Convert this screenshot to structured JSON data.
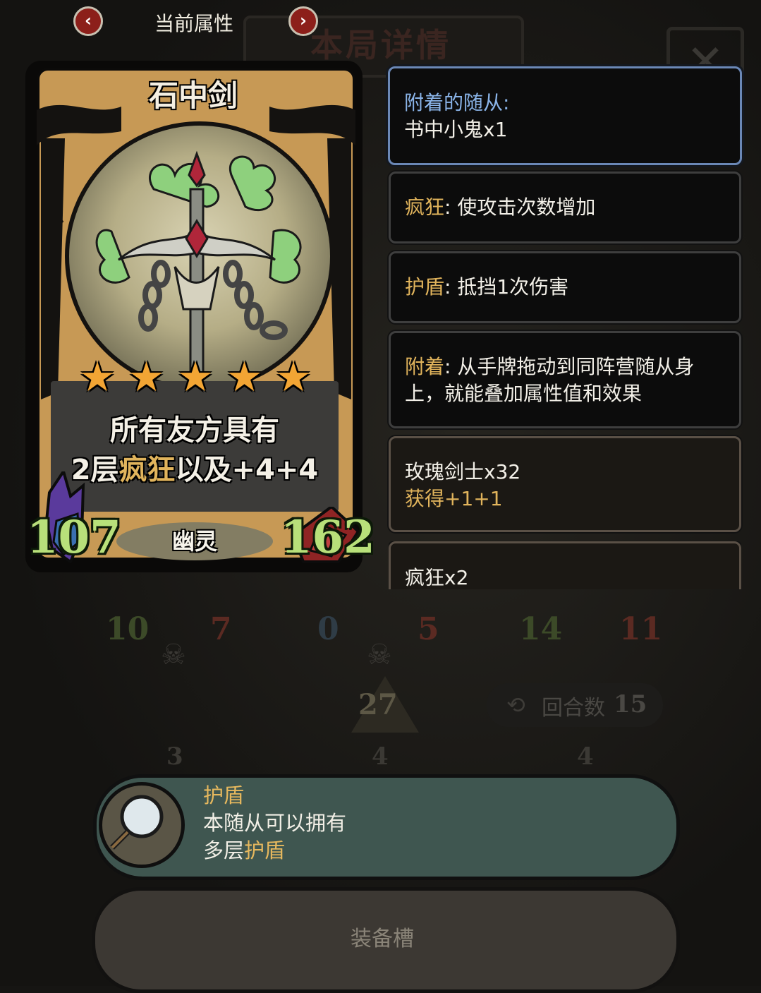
{
  "nav": {
    "prev_icon": "chevron-left-icon",
    "next_icon": "chevron-right-icon",
    "title": "当前属性"
  },
  "background": {
    "panel_title": "本局详情",
    "close_icon": "close-icon"
  },
  "card": {
    "name": "石中剑",
    "stars": 5,
    "desc_line1": "所有友方具有",
    "desc_line2_prefix": "2层",
    "desc_line2_keyword": "疯狂",
    "desc_line2_suffix": "以及+4+4",
    "type": "幽灵",
    "attack": "107",
    "health": "162"
  },
  "panels": [
    {
      "keyword": "附着的随从:",
      "text": "书中小鬼x1"
    },
    {
      "keyword": "疯狂",
      "text": ": 使攻击次数增加"
    },
    {
      "keyword": "护盾",
      "text": ": 抵挡1次伤害"
    },
    {
      "keyword": "附着",
      "text": ": 从手牌拖动到同阵营随从身",
      "text2": "上，就能叠加属性值和效果"
    },
    {
      "line1": "玫瑰剑士x32",
      "line2": "获得+1+1"
    },
    {
      "line1": "疯狂x2"
    }
  ],
  "board": {
    "units": [
      {
        "atk": "10",
        "hp": "7"
      },
      {
        "atk": "0",
        "hp": "5"
      },
      {
        "atk": "14",
        "hp": "11"
      }
    ],
    "gold": "27",
    "round_label": "回合数",
    "round_value": "15",
    "costs": [
      "3",
      "4",
      "4"
    ]
  },
  "tooltip": {
    "title": "护盾",
    "line1": "本随从可以拥有",
    "line2_prefix": "多层",
    "line2_keyword": "护盾",
    "icon": "magnifier-shield-icon"
  },
  "equip_slot": {
    "label": "装备槽"
  },
  "colors": {
    "keyword": "#e1b45c",
    "attack": "#b8e07a",
    "tooltip_bg": "#3f5650",
    "selected_border": "#6b88b6"
  }
}
